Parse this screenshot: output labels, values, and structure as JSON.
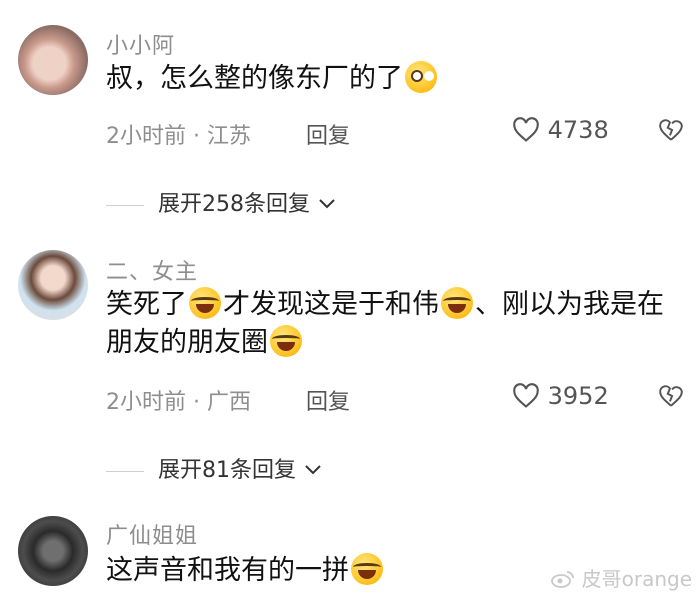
{
  "comments": [
    {
      "username": "小小阿",
      "text": "叔，怎么整的像东厂的了",
      "emoji_after": "pleading-face",
      "time": "2小时前",
      "location": "江苏",
      "reply_label": "回复",
      "likes": "4738",
      "expand_label": "展开258条回复"
    },
    {
      "username": "二、女主",
      "text_part1": "笑死了",
      "text_part2": "才发现这是于和伟",
      "text_part3": "、刚以为我是在朋友的朋友圈",
      "time": "2小时前",
      "location": "广西",
      "reply_label": "回复",
      "likes": "3952",
      "expand_label": "展开81条回复"
    },
    {
      "username": "广仙姐姐",
      "text": "这声音和我有的一拼",
      "emoji_after": "laughing-face"
    }
  ],
  "watermark": "皮哥orange",
  "colors": {
    "meta": "#8e8e8e",
    "text": "#111111",
    "emoji": "#ffc629"
  }
}
